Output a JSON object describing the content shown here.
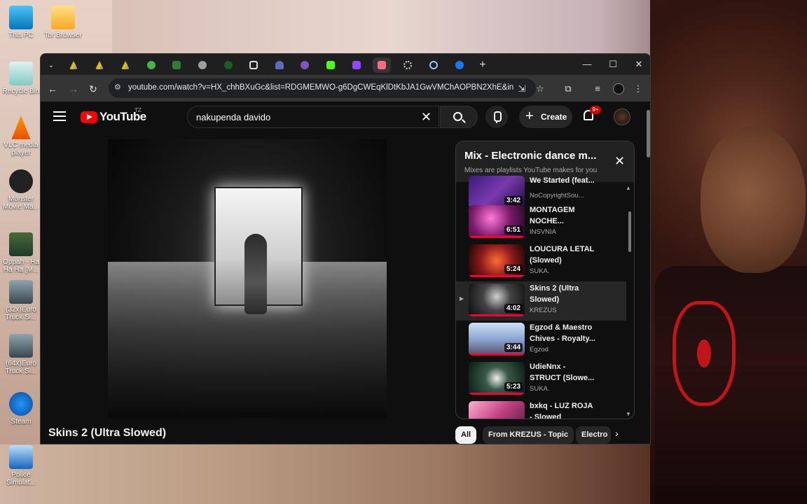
{
  "desktop": {
    "icons": [
      {
        "label": "This PC"
      },
      {
        "label": "Tor Browser"
      },
      {
        "label": "Recycle Bin"
      },
      {
        "label": "VLC media player"
      },
      {
        "label": "Monster Movie Ma..."
      },
      {
        "label": "Oppah - Ha Ha Ha [M..."
      },
      {
        "label": "(32x)Euro Truck Si..."
      },
      {
        "label": "(64x)Euro Truck Si..."
      },
      {
        "label": "Steam"
      },
      {
        "label": "Police Simulat..."
      }
    ]
  },
  "browser": {
    "window_controls": {
      "minimize": "—",
      "maximize": "☐",
      "close": "✕"
    },
    "address": {
      "url": "youtube.com/watch?v=HX_chhBXuGc&list=RDGMEMWO-g6DgCWEqKlDtKbJA1GwVMChAOPBN2XhE&inde..."
    },
    "new_tab": "+"
  },
  "youtube": {
    "logo_text": "YouTube",
    "country_code": "TZ",
    "search_value": "nakupenda davido",
    "create_label": "Create",
    "notifications_badge": "9+",
    "video_title": "Skins 2 (Ultra Slowed)",
    "playlist": {
      "title": "Mix - Electronic dance m...",
      "subtitle": "Mixes are playlists YouTube makes for you",
      "items": [
        {
          "title": "We Started (feat...",
          "channel": "NoCopyrightSou...",
          "duration": "3:42",
          "current": false
        },
        {
          "title": "MONTAGEM NOCHE...",
          "channel": "INSVNIA",
          "duration": "6:51",
          "current": false
        },
        {
          "title": "LOUCURA LETAL (Slowed)",
          "channel": "SUKA.",
          "duration": "5:24",
          "current": false
        },
        {
          "title": "Skins 2 (Ultra Slowed)",
          "channel": "KREZUS",
          "duration": "4:02",
          "current": true
        },
        {
          "title": "Egzod & Maestro Chives - Royalty...",
          "channel": "Egzod",
          "duration": "3:44",
          "current": false
        },
        {
          "title": "UdieNnx - STRUCT (Slowe...",
          "channel": "SUKA.",
          "duration": "5:23",
          "current": false
        },
        {
          "title": "bxkq - LUZ ROJA - Slowed (Official...",
          "channel": "",
          "duration": "",
          "current": false
        }
      ]
    },
    "chips": [
      {
        "label": "All",
        "active": true
      },
      {
        "label": "From KREZUS - Topic",
        "active": false
      },
      {
        "label": "Electro",
        "active": false
      }
    ]
  }
}
